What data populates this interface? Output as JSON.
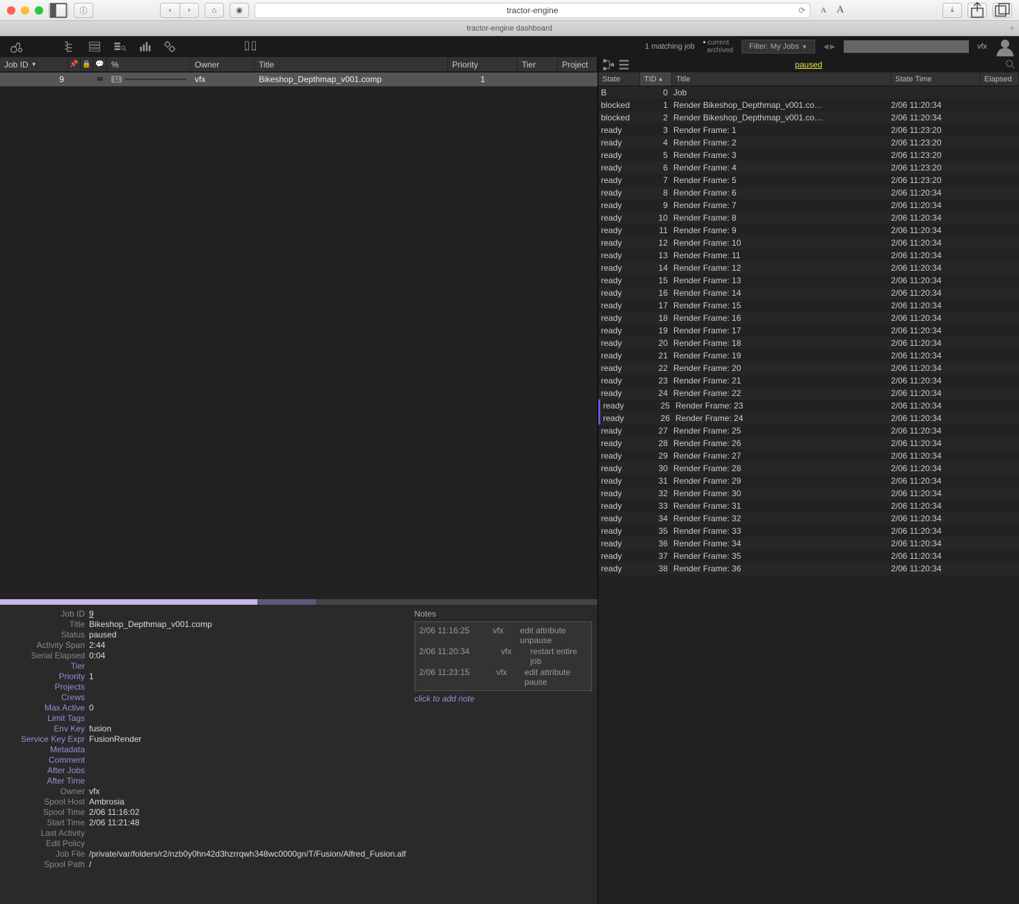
{
  "browser": {
    "url": "tractor-engine",
    "tab_title": "tractor-engine dashboard"
  },
  "toolbar": {
    "matching": "1 matching job",
    "current": "current",
    "archived": "archived",
    "filter": "Filter: My Jobs",
    "user": "vfx"
  },
  "job_columns": {
    "jobid": "Job ID",
    "pct": "%",
    "owner": "Owner",
    "title": "Title",
    "priority": "Priority",
    "tier": "Tier",
    "project": "Project"
  },
  "job_row": {
    "id": "9",
    "pct": "11",
    "owner": "vfx",
    "title": "Bikeshop_Depthmap_v001.comp",
    "priority": "1"
  },
  "detail": {
    "labels": {
      "jobid": "Job ID",
      "title": "Title",
      "status": "Status",
      "activity": "Activity Span",
      "elapsed": "Serial Elapsed",
      "tier": "Tier",
      "priority": "Priority",
      "projects": "Projects",
      "crews": "Crews",
      "maxactive": "Max Active",
      "limittags": "Limit Tags",
      "envkey": "Env Key",
      "svckey": "Service Key Expr",
      "metadata": "Metadata",
      "comment": "Comment",
      "afterjobs": "After Jobs",
      "aftertime": "After Time",
      "owner": "Owner",
      "spoolhost": "Spool Host",
      "spooltime": "Spool Time",
      "starttime": "Start Time",
      "lastactivity": "Last Activity",
      "editpolicy": "Edit Policy",
      "jobfile": "Job File",
      "spoolpath": "Spool Path"
    },
    "jobid": "9",
    "title": "Bikeshop_Depthmap_v001.comp",
    "status": "paused",
    "activity": "2:44",
    "elapsed": "0:04",
    "priority": "1",
    "maxactive": "0",
    "envkey": "fusion",
    "svckey": "FusionRender",
    "owner": "vfx",
    "spoolhost": "Ambrosia",
    "spooltime": "2/06 11:16:02",
    "starttime": "2/06 11:21:48",
    "jobfile": "/private/var/folders/r2/nzb0y0hn42d3hzrrqwh348wc0000gn/T/Fusion/Alfred_Fusion.alf",
    "spoolpath": "/"
  },
  "notes": {
    "title": "Notes",
    "rows": [
      {
        "time": "2/06 11:16:25",
        "user": "vfx",
        "msg": "edit attribute unpause"
      },
      {
        "time": "2/06 11:20:34",
        "user": "vfx",
        "msg": "restart entire job"
      },
      {
        "time": "2/06 11:23:15",
        "user": "vfx",
        "msg": "edit attribute pause"
      }
    ],
    "add": "click to add note"
  },
  "right": {
    "paused": "paused",
    "columns": {
      "state": "State",
      "tid": "TID",
      "title": "Title",
      "time": "State Time",
      "elapsed": "Elapsed"
    }
  },
  "tasks": [
    {
      "state": "B",
      "tid": "0",
      "title": "Job",
      "time": ""
    },
    {
      "state": "blocked",
      "tid": "1",
      "title": "Render Bikeshop_Depthmap_v001.co…",
      "time": "2/06 11:20:34"
    },
    {
      "state": "blocked",
      "tid": "2",
      "title": "Render Bikeshop_Depthmap_v001.co…",
      "time": "2/06 11:20:34"
    },
    {
      "state": "ready",
      "tid": "3",
      "title": "Render Frame: 1",
      "time": "2/06 11:23:20"
    },
    {
      "state": "ready",
      "tid": "4",
      "title": "Render Frame: 2",
      "time": "2/06 11:23:20"
    },
    {
      "state": "ready",
      "tid": "5",
      "title": "Render Frame: 3",
      "time": "2/06 11:23:20"
    },
    {
      "state": "ready",
      "tid": "6",
      "title": "Render Frame: 4",
      "time": "2/06 11:23:20"
    },
    {
      "state": "ready",
      "tid": "7",
      "title": "Render Frame: 5",
      "time": "2/06 11:23:20"
    },
    {
      "state": "ready",
      "tid": "8",
      "title": "Render Frame: 6",
      "time": "2/06 11:20:34"
    },
    {
      "state": "ready",
      "tid": "9",
      "title": "Render Frame: 7",
      "time": "2/06 11:20:34"
    },
    {
      "state": "ready",
      "tid": "10",
      "title": "Render Frame: 8",
      "time": "2/06 11:20:34"
    },
    {
      "state": "ready",
      "tid": "11",
      "title": "Render Frame: 9",
      "time": "2/06 11:20:34"
    },
    {
      "state": "ready",
      "tid": "12",
      "title": "Render Frame: 10",
      "time": "2/06 11:20:34"
    },
    {
      "state": "ready",
      "tid": "13",
      "title": "Render Frame: 11",
      "time": "2/06 11:20:34"
    },
    {
      "state": "ready",
      "tid": "14",
      "title": "Render Frame: 12",
      "time": "2/06 11:20:34"
    },
    {
      "state": "ready",
      "tid": "15",
      "title": "Render Frame: 13",
      "time": "2/06 11:20:34"
    },
    {
      "state": "ready",
      "tid": "16",
      "title": "Render Frame: 14",
      "time": "2/06 11:20:34"
    },
    {
      "state": "ready",
      "tid": "17",
      "title": "Render Frame: 15",
      "time": "2/06 11:20:34"
    },
    {
      "state": "ready",
      "tid": "18",
      "title": "Render Frame: 16",
      "time": "2/06 11:20:34"
    },
    {
      "state": "ready",
      "tid": "19",
      "title": "Render Frame: 17",
      "time": "2/06 11:20:34"
    },
    {
      "state": "ready",
      "tid": "20",
      "title": "Render Frame: 18",
      "time": "2/06 11:20:34"
    },
    {
      "state": "ready",
      "tid": "21",
      "title": "Render Frame: 19",
      "time": "2/06 11:20:34"
    },
    {
      "state": "ready",
      "tid": "22",
      "title": "Render Frame: 20",
      "time": "2/06 11:20:34"
    },
    {
      "state": "ready",
      "tid": "23",
      "title": "Render Frame: 21",
      "time": "2/06 11:20:34"
    },
    {
      "state": "ready",
      "tid": "24",
      "title": "Render Frame: 22",
      "time": "2/06 11:20:34"
    },
    {
      "state": "ready",
      "tid": "25",
      "title": "Render Frame: 23",
      "time": "2/06 11:20:34",
      "hl": true
    },
    {
      "state": "ready",
      "tid": "26",
      "title": "Render Frame: 24",
      "time": "2/06 11:20:34",
      "hl": true
    },
    {
      "state": "ready",
      "tid": "27",
      "title": "Render Frame: 25",
      "time": "2/06 11:20:34"
    },
    {
      "state": "ready",
      "tid": "28",
      "title": "Render Frame: 26",
      "time": "2/06 11:20:34"
    },
    {
      "state": "ready",
      "tid": "29",
      "title": "Render Frame: 27",
      "time": "2/06 11:20:34"
    },
    {
      "state": "ready",
      "tid": "30",
      "title": "Render Frame: 28",
      "time": "2/06 11:20:34"
    },
    {
      "state": "ready",
      "tid": "31",
      "title": "Render Frame: 29",
      "time": "2/06 11:20:34"
    },
    {
      "state": "ready",
      "tid": "32",
      "title": "Render Frame: 30",
      "time": "2/06 11:20:34"
    },
    {
      "state": "ready",
      "tid": "33",
      "title": "Render Frame: 31",
      "time": "2/06 11:20:34"
    },
    {
      "state": "ready",
      "tid": "34",
      "title": "Render Frame: 32",
      "time": "2/06 11:20:34"
    },
    {
      "state": "ready",
      "tid": "35",
      "title": "Render Frame: 33",
      "time": "2/06 11:20:34"
    },
    {
      "state": "ready",
      "tid": "36",
      "title": "Render Frame: 34",
      "time": "2/06 11:20:34"
    },
    {
      "state": "ready",
      "tid": "37",
      "title": "Render Frame: 35",
      "time": "2/06 11:20:34"
    },
    {
      "state": "ready",
      "tid": "38",
      "title": "Render Frame: 36",
      "time": "2/06 11:20:34"
    }
  ]
}
